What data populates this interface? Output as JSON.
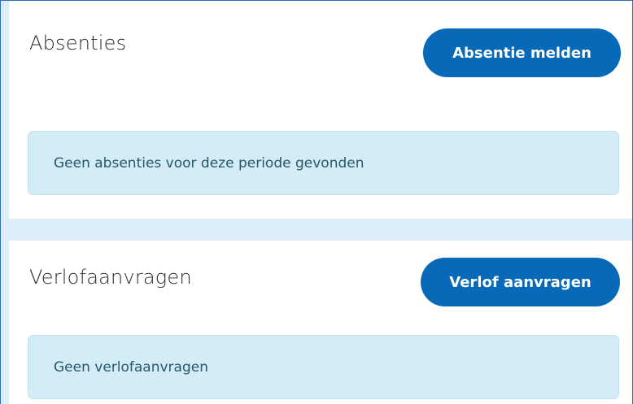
{
  "absences": {
    "title": "Absenties",
    "report_button": "Absentie melden",
    "empty_message": "Geen absenties voor deze periode gevonden"
  },
  "leave_requests": {
    "title": "Verlofaanvragen",
    "request_button": "Verlof aanvragen",
    "empty_message": "Geen verlofaanvragen"
  },
  "colors": {
    "button_bg": "#0769b7",
    "alert_bg": "#d3ecf6",
    "page_bg": "#dceefa"
  }
}
